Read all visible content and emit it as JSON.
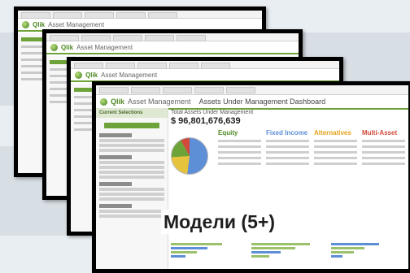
{
  "caption": "Модели (5+)",
  "card": {
    "brand": "Qlik",
    "brand_rest": "Asset Management",
    "dashboard_title": "Assets Under Management Dashboard",
    "side_header": "Current Selections",
    "main_title": "Total Assets Under Management",
    "total_value": "$ 96,801,676,639",
    "column_headers": [
      "Equity",
      "Fixed Income",
      "Alternatives",
      "Multi-Asset"
    ]
  },
  "colors": {
    "qlik_green": "#6ea33a",
    "equity": "#4f8a23",
    "fixed_income": "#5d8fd6",
    "alternatives": "#e6a21c",
    "multi_asset": "#d24a3c"
  }
}
